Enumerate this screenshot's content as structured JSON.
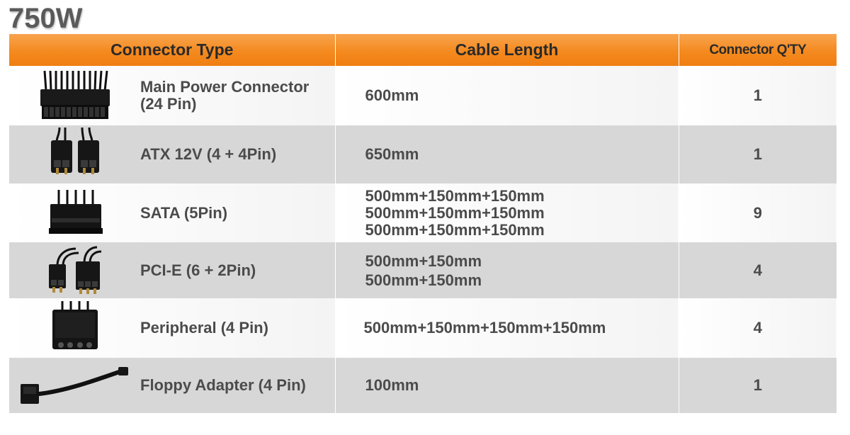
{
  "title": "750W",
  "headers": {
    "type": "Connector Type",
    "length": "Cable Length",
    "qty": "Connector Q'TY"
  },
  "rows": [
    {
      "icon": "atx-24pin-connector-icon",
      "name_lines": [
        "Main Power Connector",
        "(24 Pin)"
      ],
      "lengths": [
        "600mm"
      ],
      "qty": "1"
    },
    {
      "icon": "atx-12v-connector-icon",
      "name_lines": [
        "ATX 12V (4 + 4Pin)"
      ],
      "lengths": [
        "650mm"
      ],
      "qty": "1"
    },
    {
      "icon": "sata-connector-icon",
      "name_lines": [
        "SATA (5Pin)"
      ],
      "lengths": [
        "500mm+150mm+150mm",
        "500mm+150mm+150mm",
        "500mm+150mm+150mm"
      ],
      "qty": "9"
    },
    {
      "icon": "pcie-connector-icon",
      "name_lines": [
        "PCI-E (6 + 2Pin)"
      ],
      "lengths": [
        "500mm+150mm",
        "500mm+150mm"
      ],
      "qty": "4"
    },
    {
      "icon": "molex-peripheral-connector-icon",
      "name_lines": [
        "Peripheral (4 Pin)"
      ],
      "lengths": [
        "500mm+150mm+150mm+150mm"
      ],
      "qty": "4"
    },
    {
      "icon": "floppy-adapter-cable-icon",
      "name_lines": [
        "Floppy Adapter (4 Pin)"
      ],
      "lengths": [
        "100mm"
      ],
      "qty": "1"
    }
  ],
  "colors": {
    "header_orange": "#f48a1f",
    "row_gray": "#d7d7d7",
    "text_gray": "#4b4b4b"
  }
}
